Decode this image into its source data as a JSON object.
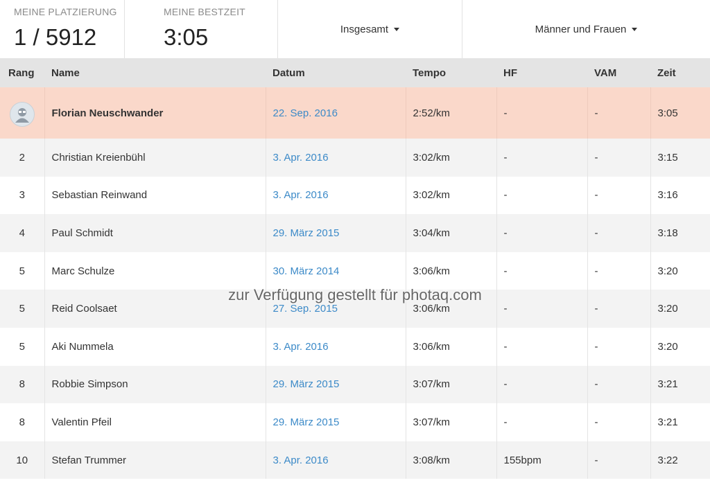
{
  "summary": {
    "placement_label": "MEINE PLATZIERUNG",
    "placement_value": "1 / 5912",
    "besttime_label": "MEINE BESTZEIT",
    "besttime_value": "3:05",
    "filter_scope": "Insgesamt",
    "filter_gender": "Männer und Frauen"
  },
  "table": {
    "headers": [
      "Rang",
      "Name",
      "Datum",
      "Tempo",
      "HF",
      "VAM",
      "Zeit"
    ],
    "rows": [
      {
        "rank": "",
        "name": "Florian Neuschwander",
        "date": "22. Sep. 2016",
        "pace": "2:52/km",
        "hf": "-",
        "vam": "-",
        "time": "3:05"
      },
      {
        "rank": "2",
        "name": "Christian Kreienbühl",
        "date": "3. Apr. 2016",
        "pace": "3:02/km",
        "hf": "-",
        "vam": "-",
        "time": "3:15"
      },
      {
        "rank": "3",
        "name": "Sebastian Reinwand",
        "date": "3. Apr. 2016",
        "pace": "3:02/km",
        "hf": "-",
        "vam": "-",
        "time": "3:16"
      },
      {
        "rank": "4",
        "name": "Paul Schmidt",
        "date": "29. März 2015",
        "pace": "3:04/km",
        "hf": "-",
        "vam": "-",
        "time": "3:18"
      },
      {
        "rank": "5",
        "name": "Marc Schulze",
        "date": "30. März 2014",
        "pace": "3:06/km",
        "hf": "-",
        "vam": "-",
        "time": "3:20"
      },
      {
        "rank": "5",
        "name": "Reid Coolsaet",
        "date": "27. Sep. 2015",
        "pace": "3:06/km",
        "hf": "-",
        "vam": "-",
        "time": "3:20"
      },
      {
        "rank": "5",
        "name": "Aki Nummela",
        "date": "3. Apr. 2016",
        "pace": "3:06/km",
        "hf": "-",
        "vam": "-",
        "time": "3:20"
      },
      {
        "rank": "8",
        "name": "Robbie Simpson",
        "date": "29. März 2015",
        "pace": "3:07/km",
        "hf": "-",
        "vam": "-",
        "time": "3:21"
      },
      {
        "rank": "8",
        "name": "Valentin Pfeil",
        "date": "29. März 2015",
        "pace": "3:07/km",
        "hf": "-",
        "vam": "-",
        "time": "3:21"
      },
      {
        "rank": "10",
        "name": "Stefan Trummer",
        "date": "3. Apr. 2016",
        "pace": "3:08/km",
        "hf": "155bpm",
        "vam": "-",
        "time": "3:22"
      }
    ]
  },
  "watermark": "zur Verfügung gestellt für photaq.com",
  "colors": {
    "highlight_row": "#fad8ca",
    "link": "#3c8ac8",
    "header_bg": "#e4e4e4"
  }
}
